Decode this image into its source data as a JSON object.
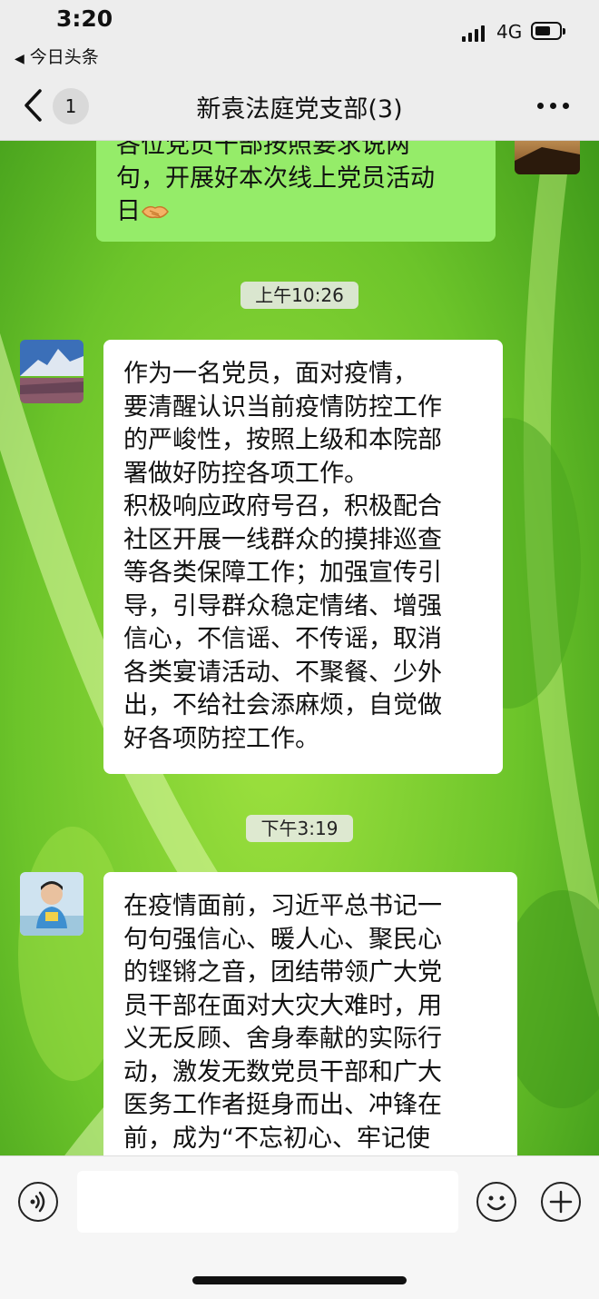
{
  "status_bar": {
    "time": "3:20",
    "back_app_label": "今日头条",
    "network": "4G"
  },
  "header": {
    "unread_count": "1",
    "title": "新袁法庭党支部(3)"
  },
  "messages": [
    {
      "type": "outgoing",
      "lines": [
        "各位党员干部按照要求说两",
        "句，开展好本次线上党员活动",
        "日"
      ],
      "emoji": "handshake"
    },
    {
      "type": "time",
      "text": "上午10:26"
    },
    {
      "type": "incoming",
      "avatar": "mountain-landscape-avatar",
      "lines": [
        "作为一名党员，面对疫情，",
        "要清醒认识当前疫情防控工作",
        "的严峻性，按照上级和本院部",
        "署做好防控各项工作。",
        "积极响应政府号召，积极配合",
        "社区开展一线群众的摸排巡查",
        "等各类保障工作；加强宣传引",
        "导，引导群众稳定情绪、增强",
        "信心，不信谣、不传谣，取消",
        "各类宴请活动、不聚餐、少外",
        "出，不给社会添麻烦，自觉做",
        "好各项防控工作。"
      ]
    },
    {
      "type": "time",
      "text": "下午3:19"
    },
    {
      "type": "incoming",
      "avatar": "child-photo-avatar",
      "lines": [
        "在疫情面前，习近平总书记一",
        "句句强信心、暖人心、聚民心",
        "的铿锵之音，团结带领广大党",
        "员干部在面对大灾大难时，用",
        "义无反顾、舍身奉献的实际行",
        "动，激发无数党员干部和广大",
        "医务工作者挺身而出、冲锋在",
        "前，成为“不忘初心、牢记使"
      ]
    }
  ],
  "input_bar": {
    "voice_icon": "voice-icon",
    "emoji_icon": "emoji-icon",
    "plus_icon": "plus-icon",
    "text_value": ""
  },
  "colors": {
    "outgoing_bubble": "#95ec69",
    "incoming_bubble": "#ffffff",
    "bar_background": "#ededed"
  }
}
